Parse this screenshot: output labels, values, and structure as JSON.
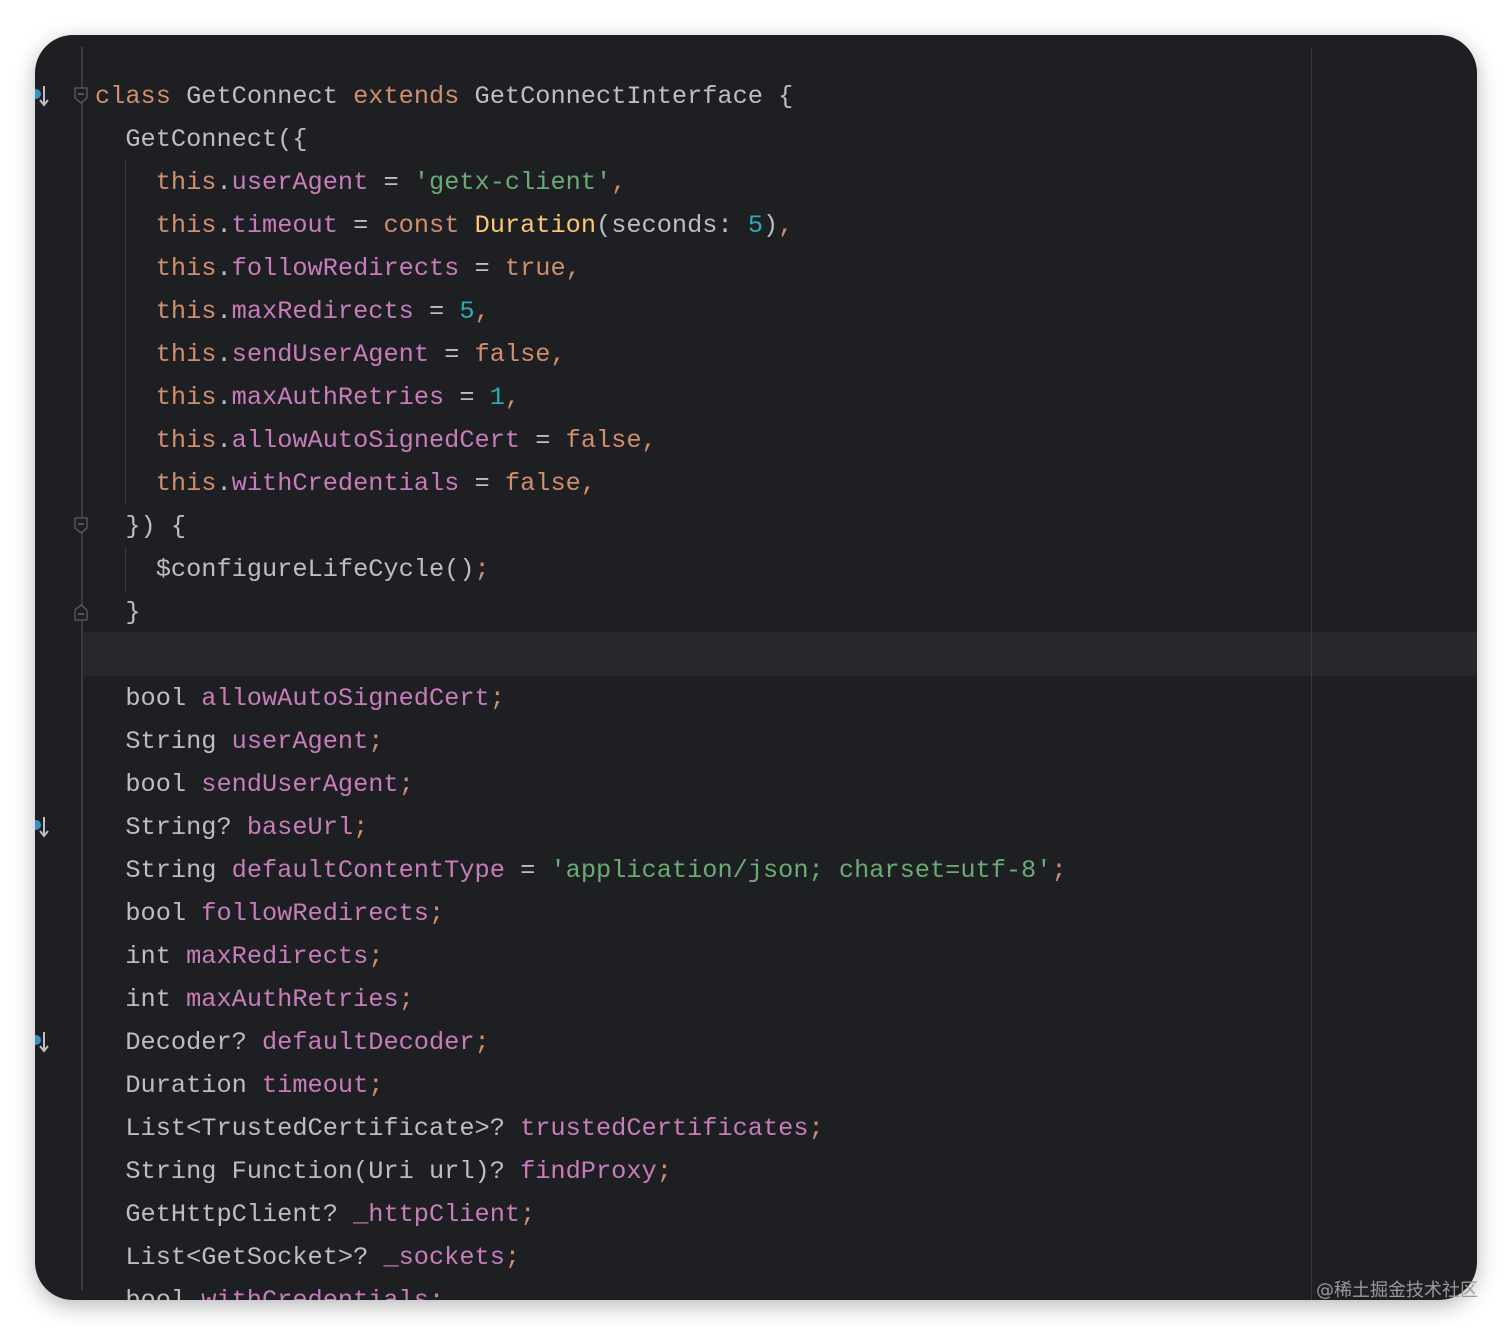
{
  "editor": {
    "lines": [
      [
        [
          "kw",
          "class "
        ],
        [
          "tx",
          "GetConnect "
        ],
        [
          "kw",
          "extends "
        ],
        [
          "tx",
          "GetConnectInterface {"
        ]
      ],
      [
        [
          "tx",
          "  GetConnect({"
        ]
      ],
      [
        [
          "tx",
          "    "
        ],
        [
          "kw",
          "this"
        ],
        [
          "tx",
          "."
        ],
        [
          "fld",
          "userAgent"
        ],
        [
          "tx",
          " = "
        ],
        [
          "str",
          "'getx-client'"
        ],
        [
          "pun",
          ","
        ]
      ],
      [
        [
          "tx",
          "    "
        ],
        [
          "kw",
          "this"
        ],
        [
          "tx",
          "."
        ],
        [
          "fld",
          "timeout"
        ],
        [
          "tx",
          " = "
        ],
        [
          "kw",
          "const "
        ],
        [
          "fn",
          "Duration"
        ],
        [
          "tx",
          "(seconds: "
        ],
        [
          "num",
          "5"
        ],
        [
          "tx",
          ")"
        ],
        [
          "pun",
          ","
        ]
      ],
      [
        [
          "tx",
          "    "
        ],
        [
          "kw",
          "this"
        ],
        [
          "tx",
          "."
        ],
        [
          "fld",
          "followRedirects"
        ],
        [
          "tx",
          " = "
        ],
        [
          "kw",
          "true"
        ],
        [
          "pun",
          ","
        ]
      ],
      [
        [
          "tx",
          "    "
        ],
        [
          "kw",
          "this"
        ],
        [
          "tx",
          "."
        ],
        [
          "fld",
          "maxRedirects"
        ],
        [
          "tx",
          " = "
        ],
        [
          "num",
          "5"
        ],
        [
          "pun",
          ","
        ]
      ],
      [
        [
          "tx",
          "    "
        ],
        [
          "kw",
          "this"
        ],
        [
          "tx",
          "."
        ],
        [
          "fld",
          "sendUserAgent"
        ],
        [
          "tx",
          " = "
        ],
        [
          "kw",
          "false"
        ],
        [
          "pun",
          ","
        ]
      ],
      [
        [
          "tx",
          "    "
        ],
        [
          "kw",
          "this"
        ],
        [
          "tx",
          "."
        ],
        [
          "fld",
          "maxAuthRetries"
        ],
        [
          "tx",
          " = "
        ],
        [
          "num",
          "1"
        ],
        [
          "pun",
          ","
        ]
      ],
      [
        [
          "tx",
          "    "
        ],
        [
          "kw",
          "this"
        ],
        [
          "tx",
          "."
        ],
        [
          "fld",
          "allowAutoSignedCert"
        ],
        [
          "tx",
          " = "
        ],
        [
          "kw",
          "false"
        ],
        [
          "pun",
          ","
        ]
      ],
      [
        [
          "tx",
          "    "
        ],
        [
          "kw",
          "this"
        ],
        [
          "tx",
          "."
        ],
        [
          "fld",
          "withCredentials"
        ],
        [
          "tx",
          " = "
        ],
        [
          "kw",
          "false"
        ],
        [
          "pun",
          ","
        ]
      ],
      [
        [
          "tx",
          "  }) {"
        ]
      ],
      [
        [
          "tx",
          "    $configureLifeCycle()"
        ],
        [
          "pun",
          ";"
        ]
      ],
      [
        [
          "tx",
          "  }"
        ]
      ],
      [
        [
          "tx",
          ""
        ]
      ],
      [
        [
          "tx",
          "  bool "
        ],
        [
          "fld",
          "allowAutoSignedCert"
        ],
        [
          "pun",
          ";"
        ]
      ],
      [
        [
          "tx",
          "  String "
        ],
        [
          "fld",
          "userAgent"
        ],
        [
          "pun",
          ";"
        ]
      ],
      [
        [
          "tx",
          "  bool "
        ],
        [
          "fld",
          "sendUserAgent"
        ],
        [
          "pun",
          ";"
        ]
      ],
      [
        [
          "tx",
          "  String? "
        ],
        [
          "fld",
          "baseUrl"
        ],
        [
          "pun",
          ";"
        ]
      ],
      [
        [
          "tx",
          "  String "
        ],
        [
          "fld",
          "defaultContentType"
        ],
        [
          "tx",
          " = "
        ],
        [
          "str",
          "'application/json; charset=utf-8'"
        ],
        [
          "pun",
          ";"
        ]
      ],
      [
        [
          "tx",
          "  bool "
        ],
        [
          "fld",
          "followRedirects"
        ],
        [
          "pun",
          ";"
        ]
      ],
      [
        [
          "tx",
          "  int "
        ],
        [
          "fld",
          "maxRedirects"
        ],
        [
          "pun",
          ";"
        ]
      ],
      [
        [
          "tx",
          "  int "
        ],
        [
          "fld",
          "maxAuthRetries"
        ],
        [
          "pun",
          ";"
        ]
      ],
      [
        [
          "tx",
          "  Decoder? "
        ],
        [
          "fld",
          "defaultDecoder"
        ],
        [
          "pun",
          ";"
        ]
      ],
      [
        [
          "tx",
          "  Duration "
        ],
        [
          "fld",
          "timeout"
        ],
        [
          "pun",
          ";"
        ]
      ],
      [
        [
          "tx",
          "  List<TrustedCertificate>? "
        ],
        [
          "fld",
          "trustedCertificates"
        ],
        [
          "pun",
          ";"
        ]
      ],
      [
        [
          "tx",
          "  String Function(Uri url)? "
        ],
        [
          "fld",
          "findProxy"
        ],
        [
          "pun",
          ";"
        ]
      ],
      [
        [
          "tx",
          "  GetHttpClient? "
        ],
        [
          "fld",
          "_httpClient"
        ],
        [
          "pun",
          ";"
        ]
      ],
      [
        [
          "tx",
          "  List<GetSocket>? "
        ],
        [
          "fld",
          "_sockets"
        ],
        [
          "pun",
          ";"
        ]
      ],
      [
        [
          "tx",
          "  bool "
        ],
        [
          "fld",
          "withCredentials"
        ],
        [
          "pun",
          ";"
        ]
      ]
    ],
    "implementation_marker_lines": [
      0,
      17,
      22
    ],
    "fold_marker_lines": [
      0,
      10,
      12
    ],
    "current_line": 13,
    "icons": {
      "implementation": "implements-arrow-icon",
      "fold": "fold-icon"
    }
  },
  "watermark": "@稀土掘金技术社区"
}
